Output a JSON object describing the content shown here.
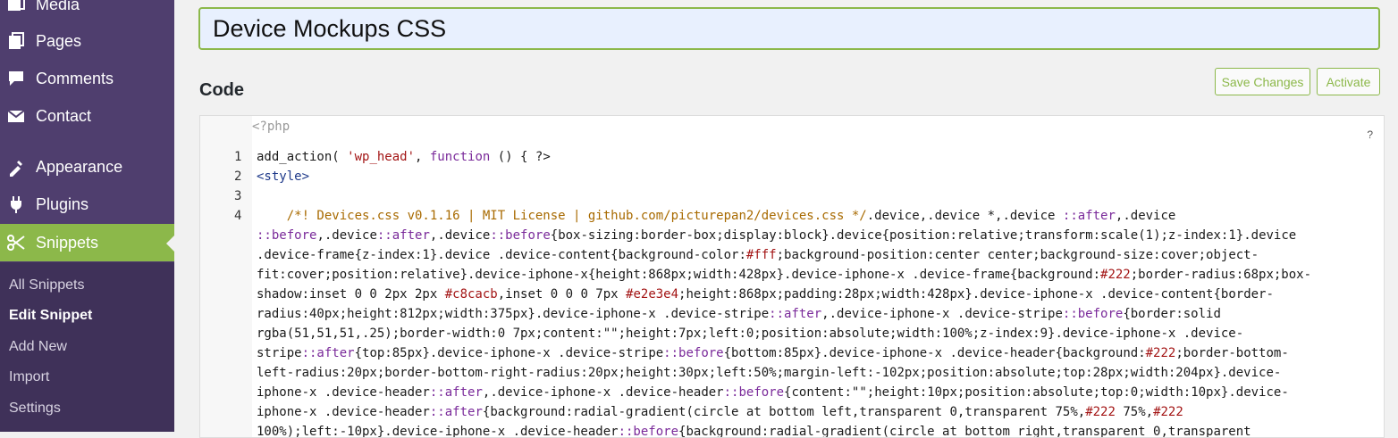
{
  "sidebar": {
    "items": [
      {
        "label": "Media",
        "icon": "media-icon"
      },
      {
        "label": "Pages",
        "icon": "pages-icon"
      },
      {
        "label": "Comments",
        "icon": "comments-icon"
      },
      {
        "label": "Contact",
        "icon": "contact-icon"
      },
      {
        "label": "Appearance",
        "icon": "appearance-icon"
      },
      {
        "label": "Plugins",
        "icon": "plugins-icon"
      },
      {
        "label": "Snippets",
        "icon": "snippets-icon",
        "active": true
      }
    ],
    "submenu": [
      "All Snippets",
      "Edit Snippet",
      "Add New",
      "Import",
      "Settings"
    ],
    "current_submenu": "Edit Snippet"
  },
  "snippet": {
    "title": "Device Mockups CSS"
  },
  "code_section": {
    "title": "Code",
    "save_label": "Save Changes",
    "activate_label": "Activate"
  },
  "editor": {
    "php_open": "<?php",
    "help": "?",
    "line_numbers": [
      "1",
      "2",
      "3",
      "4"
    ],
    "lines": [
      "add_action( 'wp_head', function () { ?>",
      "<style>",
      "",
      "    /*! Devices.css v0.1.16 | MIT License | github.com/picturepan2/devices.css */.device,.device *,.device ::after,.device",
      "::before,.device::after,.device::before{box-sizing:border-box;display:block}.device{position:relative;transform:scale(1);z-index:1}.device",
      ".device-frame{z-index:1}.device .device-content{background-color:#fff;background-position:center center;background-size:cover;object-",
      "fit:cover;position:relative}.device-iphone-x{height:868px;width:428px}.device-iphone-x .device-frame{background:#222;border-radius:68px;box-",
      "shadow:inset 0 0 2px 2px #c8cacb,inset 0 0 0 7px #e2e3e4;height:868px;padding:28px;width:428px}.device-iphone-x .device-content{border-",
      "radius:40px;height:812px;width:375px}.device-iphone-x .device-stripe::after,.device-iphone-x .device-stripe::before{border:solid",
      "rgba(51,51,51,.25);border-width:0 7px;content:\"\";height:7px;left:0;position:absolute;width:100%;z-index:9}.device-iphone-x .device-",
      "stripe::after{top:85px}.device-iphone-x .device-stripe::before{bottom:85px}.device-iphone-x .device-header{background:#222;border-bottom-",
      "left-radius:20px;border-bottom-right-radius:20px;height:30px;left:50%;margin-left:-102px;position:absolute;top:28px;width:204px}.device-",
      "iphone-x .device-header::after,.device-iphone-x .device-header::before{content:\"\";height:10px;position:absolute;top:0;width:10px}.device-",
      "iphone-x .device-header::after{background:radial-gradient(circle at bottom left,transparent 0,transparent 75%,#222 75%,#222",
      "100%);left:-10px}.device-iphone-x .device-header::before{background:radial-gradient(circle at bottom right,transparent 0,transparent"
    ]
  },
  "colors": {
    "sidebar_bg": "#4f3e6e",
    "submenu_bg": "#3f3159",
    "accent": "#8cb84a"
  }
}
